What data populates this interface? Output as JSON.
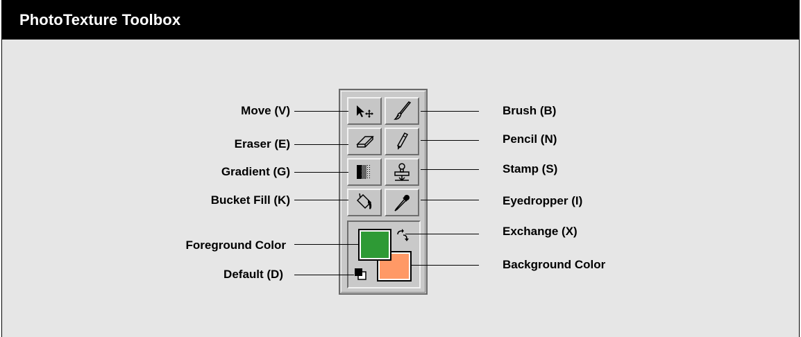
{
  "window": {
    "title": "PhotoTexture Toolbox"
  },
  "tools": [
    {
      "id": "move",
      "label": "Move  (V)",
      "icon": "move-icon"
    },
    {
      "id": "brush",
      "label": "Brush  (B)",
      "icon": "brush-icon"
    },
    {
      "id": "eraser",
      "label": "Eraser  (E)",
      "icon": "eraser-icon"
    },
    {
      "id": "pencil",
      "label": "Pencil  (N)",
      "icon": "pencil-icon"
    },
    {
      "id": "gradient",
      "label": "Gradient  (G)",
      "icon": "gradient-icon"
    },
    {
      "id": "stamp",
      "label": "Stamp  (S)",
      "icon": "stamp-icon"
    },
    {
      "id": "bucket",
      "label": "Bucket Fill (K)",
      "icon": "bucket-fill-icon"
    },
    {
      "id": "eyedropper",
      "label": "Eyedropper  (I)",
      "icon": "eyedropper-icon"
    }
  ],
  "colors": {
    "foreground_label": "Foreground Color",
    "background_label": "Background Color",
    "exchange_label": "Exchange  (X)",
    "default_label": "Default  (D)",
    "foreground": "#2e9a35",
    "background": "#ff9966"
  }
}
